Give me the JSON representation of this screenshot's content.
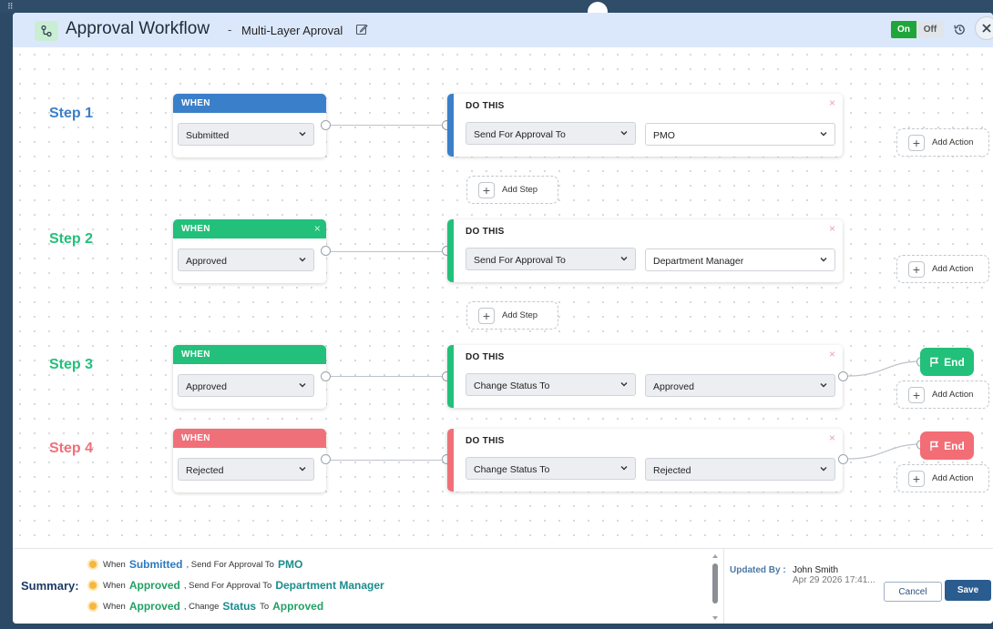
{
  "header": {
    "title": "Approval Workflow",
    "separator": "-",
    "subtitle": "Multi-Layer Aproval",
    "toggle_on": "On",
    "toggle_off": "Off"
  },
  "steps": [
    {
      "label": "Step 1",
      "color": "#3a7fc9",
      "when_title": "WHEN",
      "when_value": "Submitted",
      "do_title": "DO THIS",
      "action": "Send For Approval To",
      "target": "PMO",
      "add_action": "Add Action"
    },
    {
      "label": "Step 2",
      "color": "#22c07a",
      "when_title": "WHEN",
      "when_value": "Approved",
      "do_title": "DO THIS",
      "action": "Send For Approval To",
      "target": "Department Manager",
      "add_action": "Add Action"
    },
    {
      "label": "Step 3",
      "color": "#22c07a",
      "when_title": "WHEN",
      "when_value": "Approved",
      "do_title": "DO THIS",
      "action": "Change Status To",
      "target": "Approved",
      "add_action": "Add Action",
      "end": "End"
    },
    {
      "label": "Step 4",
      "color": "#f0707a",
      "when_title": "WHEN",
      "when_value": "Rejected",
      "do_title": "DO THIS",
      "action": "Change Status To",
      "target": "Rejected",
      "add_action": "Add Action",
      "end": "End"
    }
  ],
  "add_step": "Add Step",
  "when_close": "×",
  "do_close": "×",
  "end_colors": {
    "approved": "#22c07a",
    "rejected": "#f26d75"
  },
  "summary": {
    "label": "Summary:",
    "rows": [
      {
        "when": "When",
        "status": "Submitted",
        "comma": ",",
        "action": "Send For Approval To",
        "target": "PMO"
      },
      {
        "when": "When",
        "status": "Approved",
        "comma": ",",
        "action": "Send For Approval To",
        "target": "Department Manager"
      },
      {
        "when": "When",
        "status": "Approved",
        "comma": ",",
        "action": "Change",
        "field": "Status",
        "to": "To",
        "target": "Approved"
      }
    ]
  },
  "updated": {
    "label": "Updated By :",
    "name": "John Smith",
    "date": "Apr 29 2026 17:41..."
  },
  "buttons": {
    "cancel": "Cancel",
    "save": "Save"
  }
}
